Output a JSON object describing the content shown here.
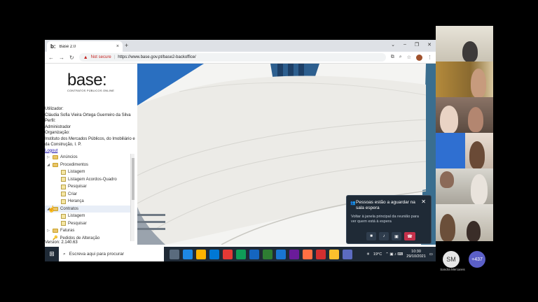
{
  "browser": {
    "tab_favicon": "b:",
    "tab_title": "Base 2.0",
    "tab_close": "×",
    "new_tab": "+",
    "window_controls": [
      "⌄",
      "–",
      "❐",
      "✕"
    ],
    "nav": {
      "back": "←",
      "forward": "→",
      "reload": "↻"
    },
    "security_icon": "warning-triangle-icon",
    "not_secure": "Not secure",
    "url": "https://www.base.gov.pt/base2-backoffice/",
    "tools": [
      "⧉",
      "⌕",
      "☆",
      "⋮"
    ]
  },
  "sidebar": {
    "logo_text": "base:",
    "logo_subtitle": "CONTRATOS PÚBLICOS ONLINE",
    "user_label": "Utilizador:",
    "user_value": "Cláudia Sofia Vieira Ortega Guerreiro da Silva",
    "profile_label": "Perfil:",
    "profile_value": "Administrador",
    "org_label": "Organização:",
    "org_value": "Instituto dos Mercados Públicos, do Imobiliário e da Construção, I. P.",
    "logout": "Logout",
    "tree": [
      {
        "label": "Anúncios",
        "level": 0,
        "expander": "▷",
        "icon": "folder"
      },
      {
        "label": "Procedimentos",
        "level": 0,
        "expander": "◢",
        "icon": "folder"
      },
      {
        "label": "Listagem",
        "level": 2,
        "expander": "",
        "icon": "page"
      },
      {
        "label": "Listagem Acordos-Quadro",
        "level": 2,
        "expander": "",
        "icon": "page"
      },
      {
        "label": "Pesquisar",
        "level": 2,
        "expander": "",
        "icon": "page"
      },
      {
        "label": "Criar",
        "level": 2,
        "expander": "",
        "icon": "page"
      },
      {
        "label": "Herança",
        "level": 2,
        "expander": "",
        "icon": "page"
      },
      {
        "label": "Contratos",
        "level": 0,
        "expander": "◢",
        "icon": "folder"
      },
      {
        "label": "Listagem",
        "level": 2,
        "expander": "",
        "icon": "page"
      },
      {
        "label": "Pesquisar",
        "level": 2,
        "expander": "",
        "icon": "page"
      },
      {
        "label": "Faturas",
        "level": 0,
        "expander": "▷",
        "icon": "folder"
      },
      {
        "label": "Pedidos de Alteração",
        "level": 0,
        "expander": "",
        "icon": "key"
      }
    ],
    "version": "Version: 2.140.63"
  },
  "taskbar": {
    "windows_icon": "⊞",
    "search_placeholder": "Escreva aqui para procurar",
    "app_colors": [
      "#5a6b7d",
      "#1e88e5",
      "#ffb300",
      "#0078d4",
      "#e53935",
      "#0f9d58",
      "#1565c0",
      "#2e7d32",
      "#1976d2",
      "#6a1b9a",
      "#ff7043",
      "#d32f2f",
      "#fbc02d",
      "#5c6bc0"
    ],
    "weather": "19°C",
    "time": "10:30",
    "date": "29/10/2021"
  },
  "notification": {
    "title": "Pessoas estão a aguardar na sala espera",
    "body": "Voltar à janela principal da reunião para ver quem está à espera",
    "close": "✕"
  },
  "participants": {
    "avatar_initials": "SM",
    "avatar_name": "Sandra Mercareis",
    "more_count": "+437"
  }
}
